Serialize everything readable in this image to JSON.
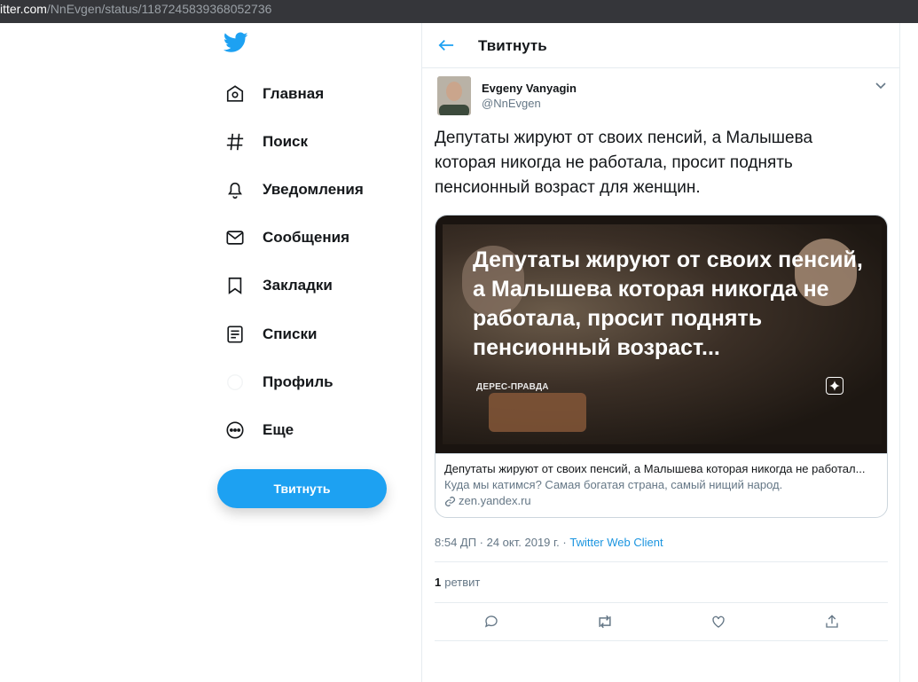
{
  "browser": {
    "url_host": "itter.com",
    "url_path": "/NnEvgen/status/1187245839368052736"
  },
  "sidebar": {
    "items": [
      {
        "label": "Главная",
        "icon": "home-icon"
      },
      {
        "label": "Поиск",
        "icon": "hashtag-icon"
      },
      {
        "label": "Уведомления",
        "icon": "bell-icon"
      },
      {
        "label": "Сообщения",
        "icon": "envelope-icon"
      },
      {
        "label": "Закладки",
        "icon": "bookmark-icon"
      },
      {
        "label": "Списки",
        "icon": "list-icon"
      },
      {
        "label": "Профиль",
        "icon": "profile-icon"
      },
      {
        "label": "Еще",
        "icon": "more-icon"
      }
    ],
    "tweet_button": "Твитнуть"
  },
  "header": {
    "title": "Твитнуть"
  },
  "tweet": {
    "author_name": "Evgeny Vanyagin",
    "author_handle": "@NnEvgen",
    "text": "Депутаты жируют от своих пенсий, а Малышева которая никогда не работала, просит поднять пенсионный возраст для женщин.",
    "card": {
      "image_headline": "Депутаты жируют от своих пенсий, а Малышева которая никогда не работала, просит поднять пенсионный возраст...",
      "image_brand": "ДЕРЕС-ПРАВДА",
      "title": "Депутаты жируют от своих пенсий, а Малышева которая никогда не работал...",
      "description": "Куда мы катимся? Самая богатая страна, самый нищий народ.",
      "domain": "zen.yandex.ru"
    },
    "timestamp": "8:54 ДП · 24 окт. 2019 г. · ",
    "client": "Twitter Web Client",
    "retweet_count": "1",
    "retweet_label": "ретвит"
  },
  "colors": {
    "accent": "#1da1f2",
    "link": "#1b95e0",
    "secondary_text": "#657786",
    "border": "#e6ecf0"
  }
}
